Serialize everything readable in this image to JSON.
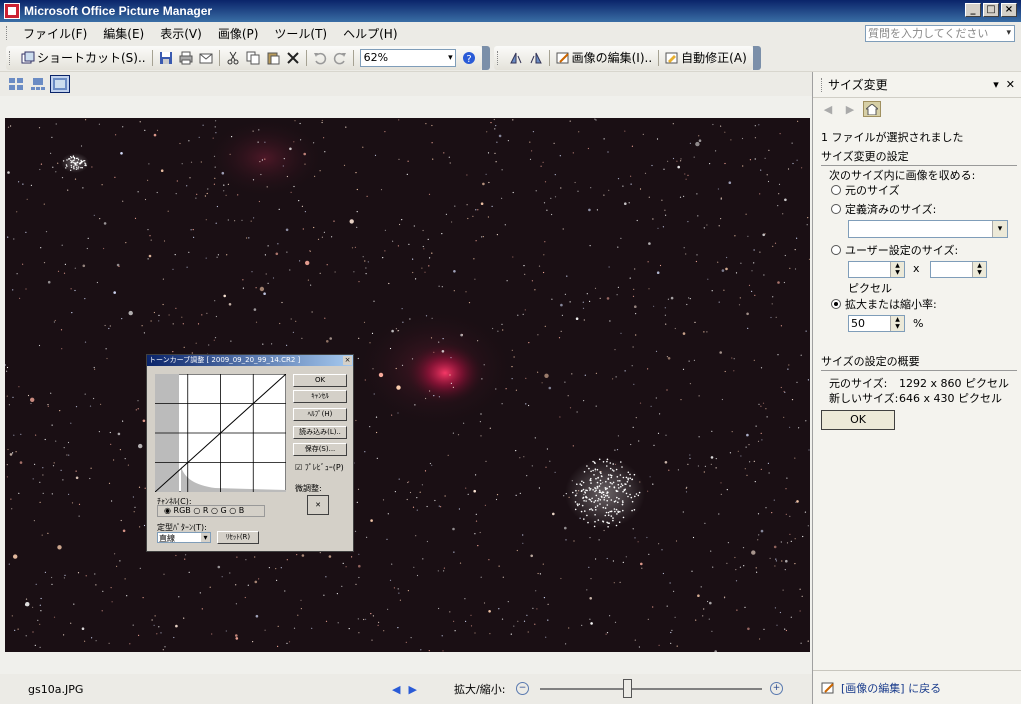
{
  "window": {
    "title": "Microsoft Office Picture Manager"
  },
  "menu": {
    "items": [
      "ファイル(F)",
      "編集(E)",
      "表示(V)",
      "画像(P)",
      "ツール(T)",
      "ヘルプ(H)"
    ],
    "help_search_placeholder": "質問を入力してください"
  },
  "toolbar": {
    "shortcut_label": "ショートカット(S)..",
    "zoom_value": "62%",
    "edit_picture_label": "画像の編集(I)..",
    "auto_correct_label": "自動修正(A)"
  },
  "dialog": {
    "title": "トーンカーブ調整 [ 2009_09_20_99_14.CR2 ]",
    "buttons": [
      "OK",
      "ｷｬﾝｾﾙ",
      "ﾍﾙﾌﾟ(H)",
      "読み込み(L)..",
      "保存(S)..."
    ],
    "preview_label": "ﾌﾟﾚﾋﾞｭｰ(P)",
    "fine_tune_label": "微調整:",
    "channel_label": "ﾁｬﾝﾈﾙ(C):",
    "channels": [
      "RGB",
      "R",
      "G",
      "B"
    ],
    "preset_label": "定型ﾊﾟﾀｰﾝ(T):",
    "preset_value": "直線",
    "reset_label": "ﾘｾｯﾄ(R)"
  },
  "pane": {
    "title": "サイズ変更",
    "selected_info": "1 ファイルが選択されました",
    "settings_head": "サイズ変更の設定",
    "fit_label": "次のサイズ内に画像を収める:",
    "opt_original": "元のサイズ",
    "opt_predefined": "定義済みのサイズ:",
    "opt_custom": "ユーザー設定のサイズ:",
    "times": "x",
    "pixels": "ピクセル",
    "opt_percent": "拡大または縮小率:",
    "percent_value": "50",
    "percent_unit": "%",
    "summary_head": "サイズの設定の概要",
    "original_size_label": "元のサイズ:",
    "original_size_value": "1292 x 860 ピクセル",
    "new_size_label": "新しいサイズ:",
    "new_size_value": "646 x 430 ピクセル",
    "ok_label": "OK",
    "back_link": "[画像の編集] に戻る"
  },
  "status": {
    "filename": "gs10a.JPG",
    "zoom_label": "拡大/縮小:",
    "zoom_level": 0.39
  }
}
